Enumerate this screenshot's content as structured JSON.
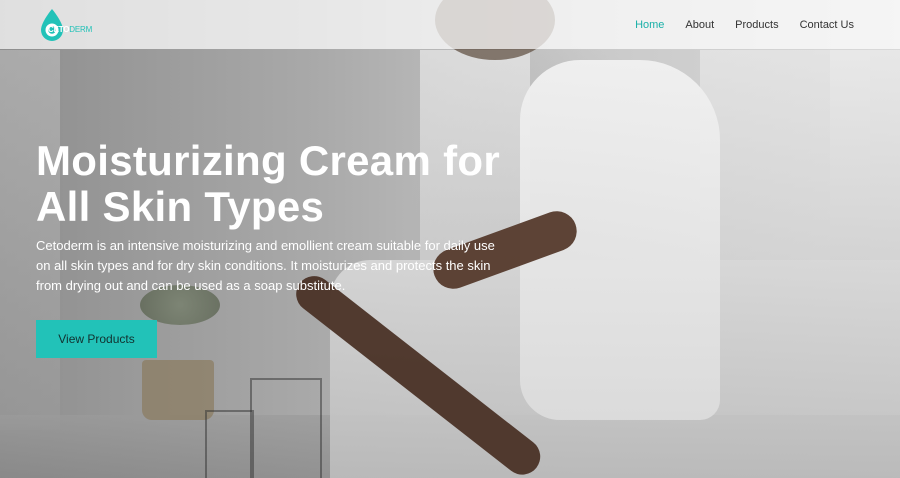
{
  "brand": {
    "logo_primary": "CETO",
    "logo_secondary": "DERM",
    "accent_color": "#22c2b8"
  },
  "nav": {
    "items": [
      {
        "label": "Home",
        "active": true
      },
      {
        "label": "About",
        "active": false
      },
      {
        "label": "Products",
        "active": false
      },
      {
        "label": "Contact Us",
        "active": false
      }
    ]
  },
  "hero": {
    "title": "Moisturizing Cream for All Skin Types",
    "description": "Cetoderm is an intensive moisturizing and emollient cream suitable for daily use on all skin types and for dry skin conditions. It moisturizes and protects the skin from drying out and can be used as a soap substitute.",
    "cta_label": "View Products"
  }
}
